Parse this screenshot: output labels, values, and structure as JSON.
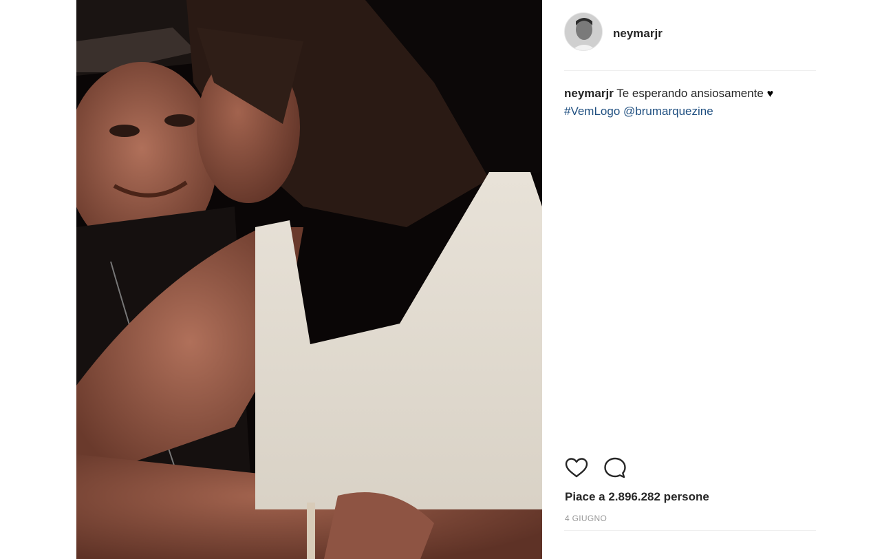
{
  "post": {
    "photo_alt": "",
    "author": "neymarjr",
    "caption": {
      "username": "neymarjr",
      "text": "Te esperando ansiosamente",
      "emoji": "♥",
      "hashtag": "#VemLogo",
      "mention": "@brumarquezine"
    },
    "actions": {
      "like_icon": "heart-outline-icon",
      "comment_icon": "speech-bubble-icon"
    },
    "likes_text": "Piace a 2.896.282 persone",
    "date": "4 GIUGNO"
  },
  "colors": {
    "link": "#1f4f80",
    "text": "#262626",
    "muted": "#999999",
    "divider": "#efefef"
  }
}
